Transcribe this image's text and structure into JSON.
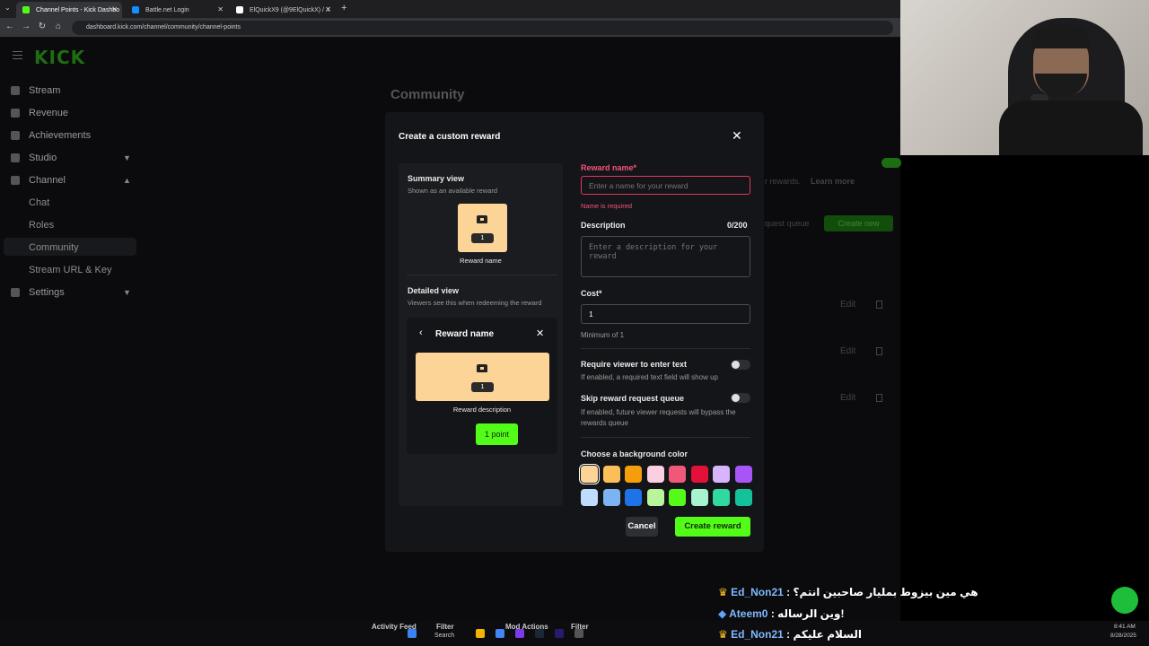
{
  "browser": {
    "tabs": [
      {
        "label": "Channel Points - Kick Dashbo",
        "active": true,
        "fav_color": "#53fc18"
      },
      {
        "label": "Battle.net Login",
        "active": false,
        "fav_color": "#148eff"
      },
      {
        "label": "ElQuickX9 (@9ElQuickX) / X",
        "active": false,
        "fav_color": "#ffffff"
      }
    ],
    "url": "dashboard.kick.com/channel/community/channel-points"
  },
  "sidebar": {
    "logo": "KICK",
    "items": [
      {
        "label": "Stream"
      },
      {
        "label": "Revenue"
      },
      {
        "label": "Achievements"
      },
      {
        "label": "Studio"
      },
      {
        "label": "Channel"
      }
    ],
    "channel_sub": [
      "Chat",
      "Roles",
      "Community",
      "Stream URL & Key"
    ],
    "settings": "Settings"
  },
  "background": {
    "page_title": "Community",
    "rewards_text": "r rewards.",
    "learn_more": "Learn more",
    "request_queue": "quest queue",
    "create_new": "Create new",
    "edit": "Edit"
  },
  "modal": {
    "title": "Create a custom reward",
    "summary_title": "Summary view",
    "summary_sub": "Shown as an available reward",
    "card_points": "1",
    "reward_name_preview": "Reward name",
    "detailed_title": "Detailed view",
    "detailed_sub": "Viewers see this when redeeming the reward",
    "detail_header": "Reward name",
    "detail_desc": "Reward description",
    "point_button": "1 point",
    "reward_name_label": "Reward name*",
    "reward_name_placeholder": "Enter a name for your reward",
    "name_error": "Name is required",
    "description_label": "Description",
    "description_count": "0/200",
    "description_placeholder": "Enter a description for your reward",
    "cost_label": "Cost*",
    "cost_value": "1",
    "cost_hint": "Minimum of 1",
    "require_text_label": "Require viewer to enter text",
    "require_text_hint": "If enabled, a required text field will show up",
    "skip_queue_label": "Skip reward request queue",
    "skip_queue_hint": "If enabled, future viewer requests will bypass the rewards queue",
    "bg_color_label": "Choose a background color",
    "colors": [
      "#fdd498",
      "#fbbf5a",
      "#f59e0b",
      "#fbcfe0",
      "#f0587a",
      "#e3113a",
      "#d8b4fe",
      "#a855f7",
      "#bfdbfe",
      "#7cb3f2",
      "#1e73e8",
      "#b9f59a",
      "#53fc18",
      "#a7f3d0",
      "#2fd9a0",
      "#14c29a"
    ],
    "cancel": "Cancel",
    "create": "Create reward"
  },
  "chat_overlay": [
    {
      "user": "Ed_Non21",
      "msg": ": هي مين بيزوط بمليار صاحبين انتم؟"
    },
    {
      "user": "Ateem0",
      "msg": ": وين الرساله!"
    },
    {
      "user": "Ed_Non21",
      "msg": ": السلام عليكم"
    }
  ],
  "taskbar": {
    "activity_feed": "Activity Feed",
    "filter": "Filter",
    "mod_actions": "Mod Actions",
    "search": "Search",
    "time": "8:41 AM",
    "date": "8/28/2025"
  }
}
